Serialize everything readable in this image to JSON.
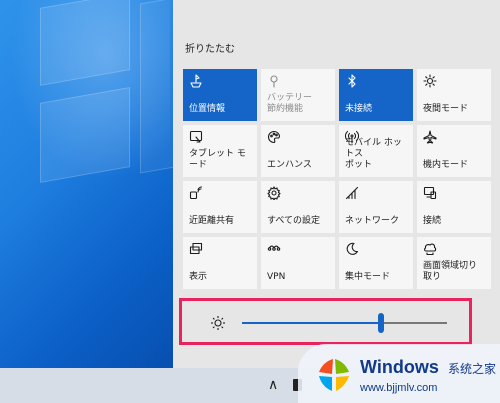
{
  "action_center": {
    "collapse_label": "折りたたむ",
    "tiles": [
      {
        "label": "位置情報",
        "icon": "location-icon",
        "state": "on"
      },
      {
        "label": "バッテリー\n節約機能",
        "icon": "battery-saver-icon",
        "state": "disabled"
      },
      {
        "label": "未接続",
        "icon": "bluetooth-icon",
        "state": "on"
      },
      {
        "label": "夜間モード",
        "icon": "night-light-icon",
        "state": "off"
      },
      {
        "label": "タブレット モード",
        "icon": "tablet-mode-icon",
        "state": "off"
      },
      {
        "label": "エンハンス",
        "icon": "palette-icon",
        "state": "off"
      },
      {
        "label": "モバイル ホットス\nポット",
        "icon": "hotspot-icon",
        "state": "off"
      },
      {
        "label": "機内モード",
        "icon": "airplane-icon",
        "state": "off"
      },
      {
        "label": "近距離共有",
        "icon": "nearby-share-icon",
        "state": "off"
      },
      {
        "label": "すべての設定",
        "icon": "gear-icon",
        "state": "off"
      },
      {
        "label": "ネットワーク",
        "icon": "network-icon",
        "state": "off"
      },
      {
        "label": "接続",
        "icon": "connect-icon",
        "state": "off"
      },
      {
        "label": "表示",
        "icon": "project-icon",
        "state": "off"
      },
      {
        "label": "VPN",
        "icon": "vpn-icon",
        "state": "off"
      },
      {
        "label": "集中モード",
        "icon": "moon-icon",
        "state": "off"
      },
      {
        "label": "画面領域切り\n取り",
        "icon": "screen-snip-icon",
        "state": "off"
      }
    ]
  },
  "brightness": {
    "icon": "brightness-icon",
    "level": 0.68
  },
  "taskbar": {
    "chevron": "∧",
    "icons": [
      "show-hidden-icons-chevron",
      "device-icon"
    ]
  },
  "watermark": {
    "brand": "Windows",
    "brand_cn": "系统之家",
    "url": "www.bjjmlv.com"
  },
  "colors": {
    "accent": "#1565c8",
    "panel_bg": "#e6e6e6",
    "tile_bg": "#f6f6f6",
    "highlight_border": "#e8235d"
  }
}
